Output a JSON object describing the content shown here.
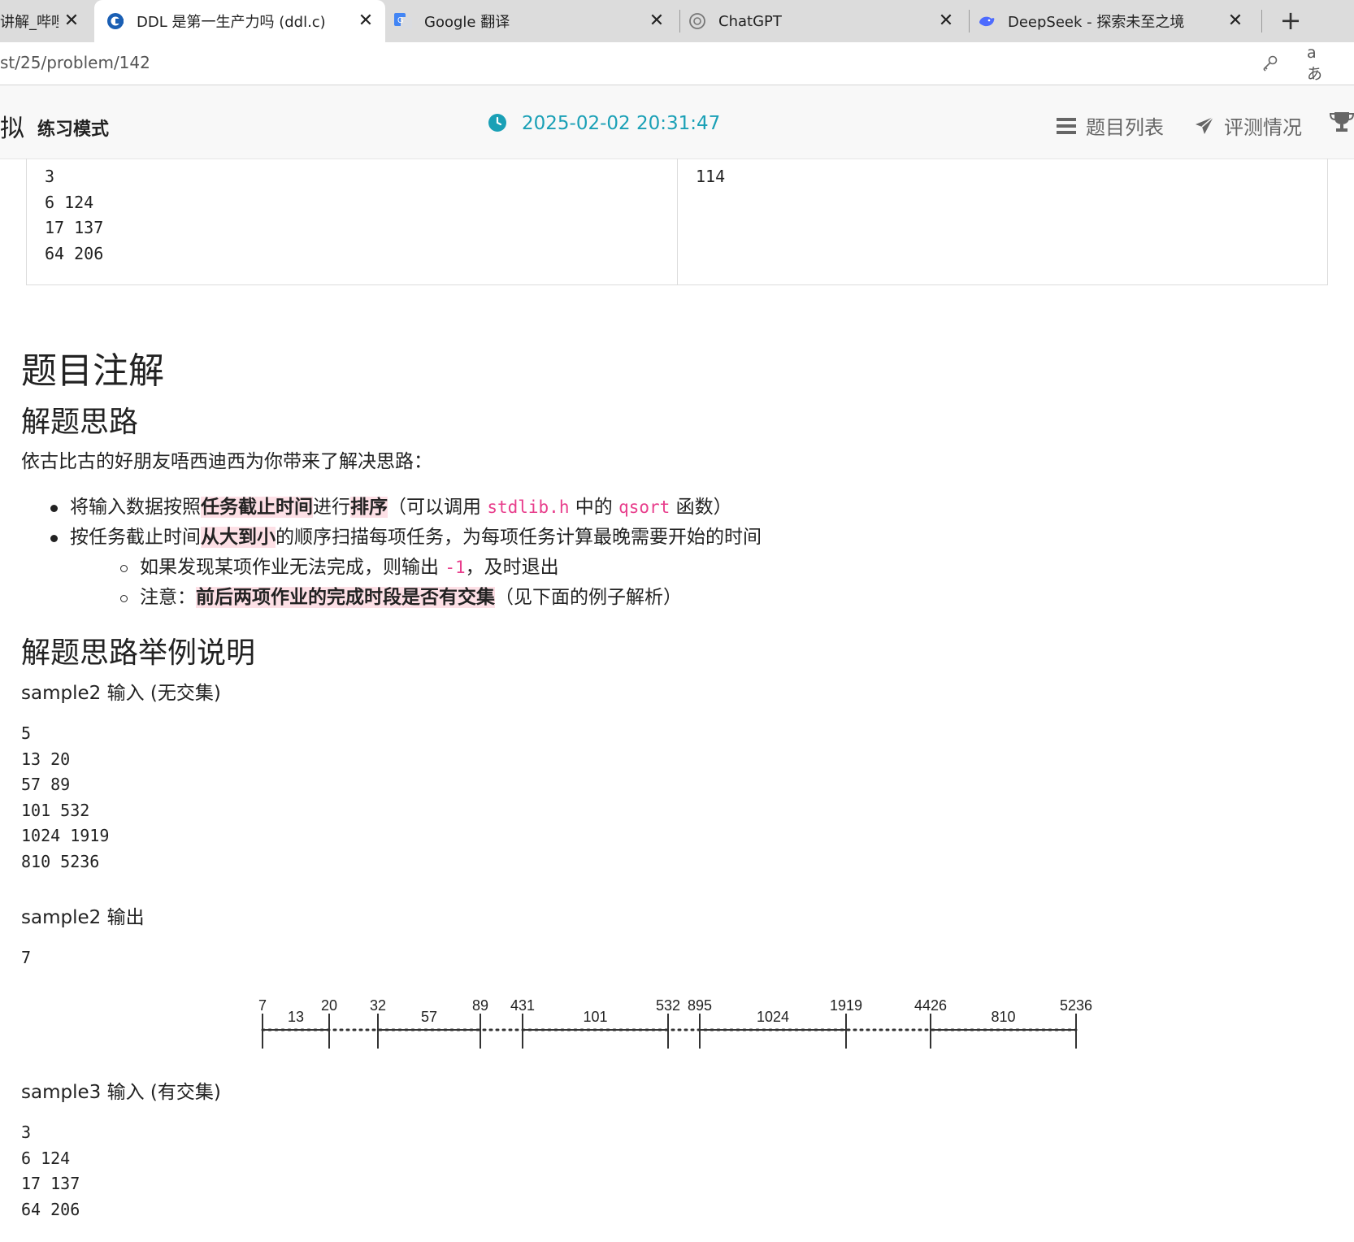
{
  "tabs": [
    {
      "title": "讲解_哔哩哔",
      "favicon": "bilibili-icon",
      "active": false
    },
    {
      "title": "DDL 是第一生产力吗 (ddl.c)",
      "favicon": "ddl-site-icon",
      "active": true
    },
    {
      "title": "Google 翻译",
      "favicon": "google-translate-icon",
      "active": false
    },
    {
      "title": "ChatGPT",
      "favicon": "chatgpt-icon",
      "active": false
    },
    {
      "title": "DeepSeek - 探索未至之境",
      "favicon": "deepseek-icon",
      "active": false
    }
  ],
  "address": {
    "url": "st/25/problem/142",
    "icons": [
      "key-icon",
      "translate-icon"
    ]
  },
  "header": {
    "brand": "拟",
    "mode": "练习模式",
    "timer": "2025-02-02 20:31:47",
    "nav": [
      {
        "label": "题目列表",
        "icon": "list-icon"
      },
      {
        "label": "评测情况",
        "icon": "send-icon"
      },
      {
        "label": "",
        "icon": "trophy-icon"
      }
    ]
  },
  "sample_table": {
    "input": "3\n6 124\n17 137\n64 206",
    "output": "114"
  },
  "content": {
    "section_title": "题目注解",
    "approach_title": "解题思路",
    "intro": "依古比古的好朋友唔西迪西为你带来了解决思路：",
    "bullet1": {
      "pre": "将输入数据按照",
      "hl1": "任务截止时间",
      "mid": "进行",
      "hl2": "排序",
      "post1": "（可以调用 ",
      "code1": "stdlib.h",
      "post2": " 中的 ",
      "code2": "qsort",
      "post3": " 函数）"
    },
    "bullet2": {
      "pre": "按任务截止时间",
      "hl": "从大到小",
      "post": "的顺序扫描每项任务，为每项任务计算最晚需要开始的时间"
    },
    "sub1": {
      "pre": "如果发现某项作业无法完成，则输出 ",
      "code": "-1",
      "post": "，及时退出"
    },
    "sub2": {
      "pre": "注意：",
      "hl": "前后两项作业的完成时段是否有交集",
      "post": "（见下面的例子解析）"
    },
    "example_title": "解题思路举例说明",
    "sample2_in_label": "sample2 输入 (无交集)",
    "sample2_in": "5\n13 20\n57 89\n101 532\n1024 1919\n810 5236",
    "sample2_out_label": "sample2 输出",
    "sample2_out": "7",
    "sample3_in_label": "sample3 输入 (有交集)",
    "sample3_in": "3\n6 124\n17 137\n64 206"
  },
  "timeline": {
    "ticks": [
      7,
      20,
      32,
      89,
      431,
      532,
      895,
      1919,
      4426,
      5236
    ],
    "segments": [
      {
        "from": 7,
        "to": 20,
        "label": "13"
      },
      {
        "from": 32,
        "to": 89,
        "label": "57"
      },
      {
        "from": 431,
        "to": 532,
        "label": "101"
      },
      {
        "from": 895,
        "to": 1919,
        "label": "1024"
      },
      {
        "from": 4426,
        "to": 5236,
        "label": "810"
      }
    ]
  }
}
